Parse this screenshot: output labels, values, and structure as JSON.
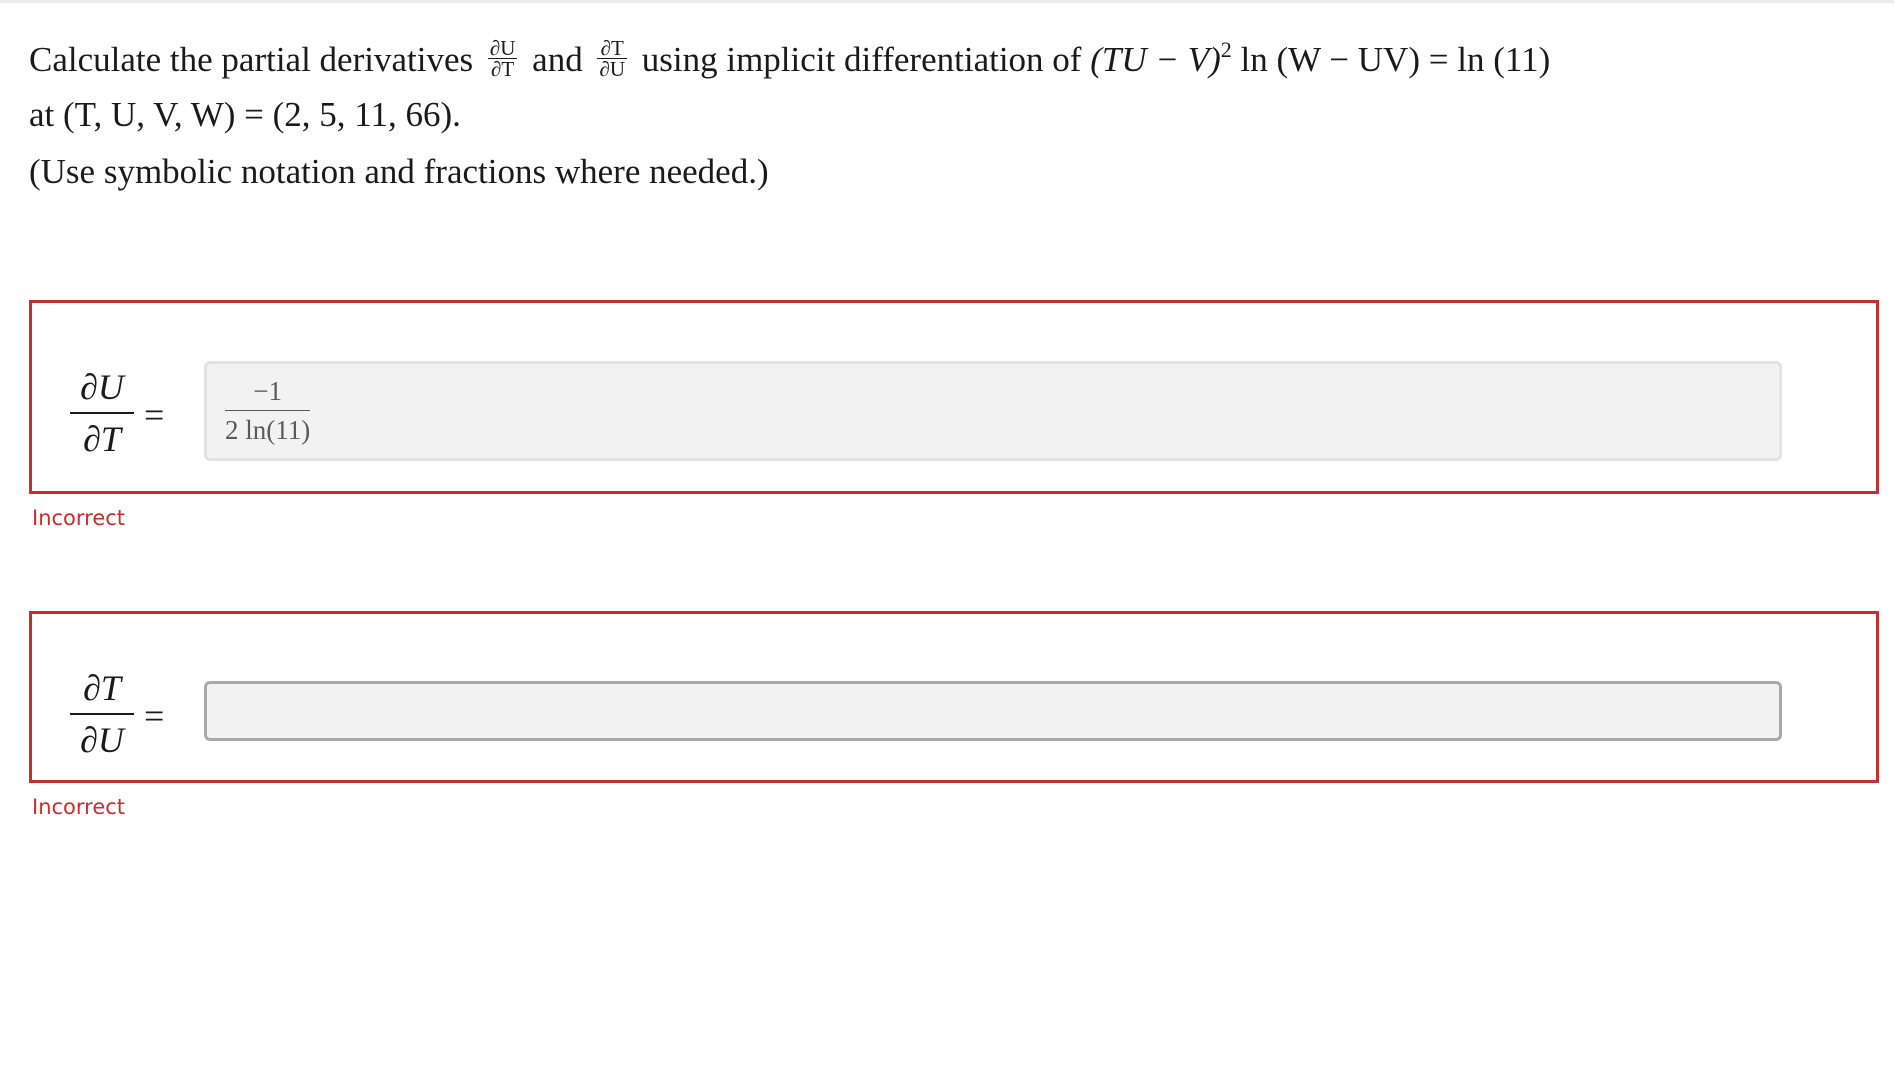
{
  "question": {
    "intro": "Calculate the partial derivatives",
    "frac1": {
      "num": "∂U",
      "den": "∂T"
    },
    "and": "and",
    "frac2": {
      "num": "∂T",
      "den": "∂U"
    },
    "using": "using implicit differentiation of",
    "equation_lhs_a": "(TU − V)",
    "equation_exp": "2",
    "equation_rest": "ln (W − UV) = ln (11)",
    "point_line": "at (T, U, V, W) = (2, 5, 11, 66).",
    "hint": "(Use symbolic notation and fractions where needed.)"
  },
  "answers": [
    {
      "derivative": {
        "num": "∂U",
        "den": "∂T"
      },
      "equals": "=",
      "value": {
        "num": "−1",
        "den": "2 ln(11)"
      },
      "status": "Incorrect"
    },
    {
      "derivative": {
        "num": "∂T",
        "den": "∂U"
      },
      "equals": "=",
      "value": "",
      "status": "Incorrect"
    }
  ],
  "colors": {
    "error": "#c62f2f",
    "field_bg": "#f2f2f2",
    "field_border_active": "#a8a8a8"
  }
}
